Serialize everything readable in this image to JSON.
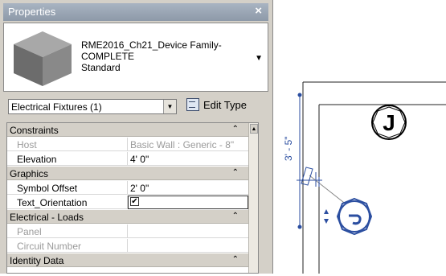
{
  "palette": {
    "title": "Properties",
    "close_glyph": "×",
    "type_name_lines": [
      "RME2016_Ch21_Device Family-",
      "COMPLETE",
      "Standard"
    ],
    "type_dropdown_glyph": "▼",
    "selector_label": "Electrical Fixtures (1)",
    "selector_arrow": "▼",
    "edit_type_label": "Edit Type",
    "rows": [
      {
        "kind": "category",
        "key": "Constraints"
      },
      {
        "kind": "param",
        "key": "Host",
        "value": "Basic Wall : Generic - 8\"",
        "gray": true
      },
      {
        "kind": "param",
        "key": "Elevation",
        "value": "4'  0\""
      },
      {
        "kind": "category",
        "key": "Graphics"
      },
      {
        "kind": "param",
        "key": "Symbol Offset",
        "value": "2'  0\""
      },
      {
        "kind": "param",
        "key": "Text_Orientation",
        "value": "",
        "checkbox": true,
        "checked": true
      },
      {
        "kind": "category",
        "key": "Electrical - Loads"
      },
      {
        "kind": "param",
        "key": "Panel",
        "value": "",
        "gray": true
      },
      {
        "kind": "param",
        "key": "Circuit Number",
        "value": "",
        "gray": true
      },
      {
        "kind": "category",
        "key": "Identity Data"
      }
    ],
    "collapse_glyph": "⌃",
    "check_glyph": "✔"
  },
  "drawing": {
    "dimension_text": "3' - 5\"",
    "tag_letter": "J",
    "line_color": "#2b4ea0"
  }
}
